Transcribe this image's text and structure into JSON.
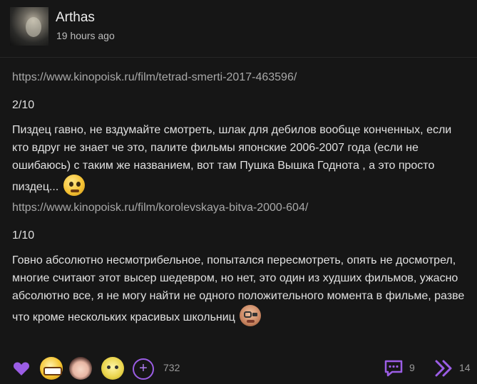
{
  "post": {
    "author": "Arthas",
    "time": "19 hours ago",
    "link1": "https://www.kinopoisk.ru/film/tetrad-smerti-2017-463596/",
    "score1": "2/10",
    "text1": "Пиздец гавно, не вздумайте смотреть, шлак для дебилов вообще конченных, если кто вдруг не знает че это, палите фильмы японские 2006-2007 года (если не ошибаюсь) с таким же названием, вот там Пушка Вышка Годнота , а это просто пиздец...",
    "emoji1": "worried-face-icon",
    "link2": "https://www.kinopoisk.ru/film/korolevskaya-bitva-2000-604/",
    "score2": "1/10",
    "text2": "Говно абсолютно несмотрибельное, попытался пересмотреть, опять не досмотрел, многие считают этот высер шедевром, но нет, это один из худших фильмов, ужасно абсолютно все, я не могу найти не одного положительного момента в фильме, разве что кроме нескольких красивых школьниц",
    "emoji2": "gentleman-face-icon"
  },
  "footer": {
    "reaction_count": "732",
    "comments_count": "9",
    "shares_count": "14"
  },
  "colors": {
    "background": "#161616",
    "accent": "#9b5de5",
    "link": "#a8a8a8"
  }
}
